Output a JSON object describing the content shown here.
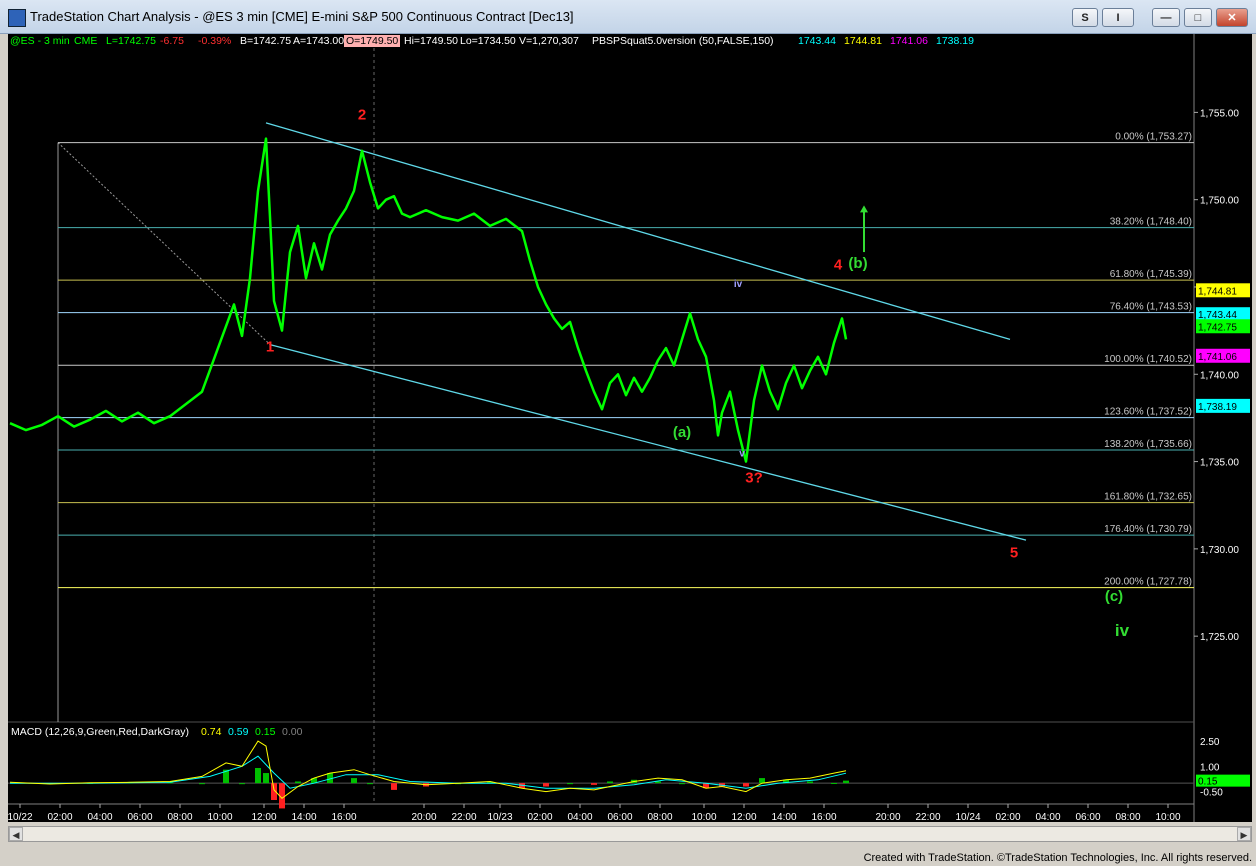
{
  "window": {
    "title": "TradeStation Chart Analysis - @ES 3 min [CME] E-mini S&P 500 Continuous Contract [Dec13]",
    "btn_s1": "S",
    "btn_s2": "I",
    "btn_min": "—",
    "btn_max": "□",
    "btn_close": "✕"
  },
  "header": {
    "symbol": "@ES - 3 min",
    "exchange": "CME",
    "last": "L=1742.75",
    "change": "-6.75",
    "pct": "-0.39%",
    "bid": "B=1742.75",
    "ask": "A=1743.00",
    "open": "O=1749.50",
    "high": "Hi=1749.50",
    "low": "Lo=1734.50",
    "volume": "V=1,270,307",
    "study": "PBSPSquat5.0version (50,FALSE,150)",
    "study_vals": [
      "1743.44",
      "1744.81",
      "1741.06",
      "1738.19"
    ]
  },
  "macd_header": {
    "label": "MACD (12,26,9,Green,Red,DarkGray)",
    "vals": [
      "0.74",
      "0.59",
      "0.15",
      "0.00"
    ]
  },
  "footer": "Created with TradeStation. ©TradeStation Technologies, Inc. All rights reserved.",
  "colors": {
    "price_bar": "#00ff00",
    "channel": "#5fd8e8",
    "wave_red": "#ff2020",
    "wave_green": "#33dd33",
    "fib_text": "#c8c8c8"
  },
  "chart_data": [
    {
      "type": "line",
      "subtype": "intraday price bars with Fibonacci levels and Elliott wave labels",
      "ylim": [
        1721.0,
        1758.0
      ],
      "y_ticks": [
        "1,755.00",
        "1,750.00",
        "1,745.00",
        "1,740.00",
        "1,735.00",
        "1,730.00",
        "1,725.00"
      ],
      "x_ticks": [
        "10/22",
        "02:00",
        "04:00",
        "06:00",
        "08:00",
        "10:00",
        "12:00",
        "14:00",
        "16:00",
        "20:00",
        "22:00",
        "10/23",
        "02:00",
        "04:00",
        "06:00",
        "08:00",
        "10:00",
        "12:00",
        "14:00",
        "16:00",
        "20:00",
        "22:00",
        "10/24",
        "02:00",
        "04:00",
        "06:00",
        "08:00",
        "10:00"
      ],
      "price_series": [
        [
          0,
          1737.2
        ],
        [
          4,
          1736.8
        ],
        [
          8,
          1737.1
        ],
        [
          12,
          1737.6
        ],
        [
          16,
          1737.0
        ],
        [
          20,
          1737.4
        ],
        [
          24,
          1737.9
        ],
        [
          28,
          1737.3
        ],
        [
          32,
          1737.8
        ],
        [
          36,
          1737.2
        ],
        [
          40,
          1737.6
        ],
        [
          44,
          1738.3
        ],
        [
          48,
          1739.0
        ],
        [
          52,
          1741.5
        ],
        [
          56,
          1744.0
        ],
        [
          58,
          1742.2
        ],
        [
          60,
          1745.5
        ],
        [
          62,
          1750.5
        ],
        [
          64,
          1753.5
        ],
        [
          65,
          1749.0
        ],
        [
          66,
          1744.2
        ],
        [
          68,
          1742.5
        ],
        [
          70,
          1747.0
        ],
        [
          72,
          1748.5
        ],
        [
          74,
          1745.5
        ],
        [
          76,
          1747.5
        ],
        [
          78,
          1746.0
        ],
        [
          80,
          1748.0
        ],
        [
          82,
          1748.8
        ],
        [
          84,
          1749.5
        ],
        [
          86,
          1750.5
        ],
        [
          88,
          1752.8
        ],
        [
          90,
          1751.0
        ],
        [
          92,
          1749.5
        ],
        [
          94,
          1750.0
        ],
        [
          96,
          1750.2
        ],
        [
          98,
          1749.2
        ],
        [
          100,
          1749.0
        ],
        [
          104,
          1749.4
        ],
        [
          108,
          1749.0
        ],
        [
          112,
          1748.8
        ],
        [
          116,
          1749.2
        ],
        [
          120,
          1748.5
        ],
        [
          124,
          1748.9
        ],
        [
          128,
          1748.2
        ],
        [
          130,
          1746.5
        ],
        [
          132,
          1745.0
        ],
        [
          134,
          1744.0
        ],
        [
          136,
          1743.2
        ],
        [
          138,
          1742.6
        ],
        [
          140,
          1743.0
        ],
        [
          142,
          1741.5
        ],
        [
          144,
          1740.2
        ],
        [
          146,
          1739.0
        ],
        [
          148,
          1738.0
        ],
        [
          150,
          1739.5
        ],
        [
          152,
          1740.0
        ],
        [
          154,
          1738.8
        ],
        [
          156,
          1739.8
        ],
        [
          158,
          1739.0
        ],
        [
          160,
          1739.8
        ],
        [
          162,
          1740.8
        ],
        [
          164,
          1741.5
        ],
        [
          166,
          1740.5
        ],
        [
          168,
          1742.0
        ],
        [
          170,
          1743.5
        ],
        [
          172,
          1742.0
        ],
        [
          174,
          1741.0
        ],
        [
          176,
          1738.5
        ],
        [
          177,
          1736.5
        ],
        [
          178,
          1737.8
        ],
        [
          180,
          1739.0
        ],
        [
          182,
          1736.8
        ],
        [
          184,
          1735.0
        ],
        [
          186,
          1738.5
        ],
        [
          188,
          1740.5
        ],
        [
          190,
          1739.0
        ],
        [
          192,
          1738.0
        ],
        [
          194,
          1739.5
        ],
        [
          196,
          1740.5
        ],
        [
          198,
          1739.2
        ],
        [
          200,
          1740.2
        ],
        [
          202,
          1741.0
        ],
        [
          204,
          1740.0
        ],
        [
          206,
          1741.8
        ],
        [
          208,
          1743.2
        ],
        [
          209,
          1742.0
        ]
      ],
      "overlay_levels": [
        {
          "label": "1,744.81",
          "value": 1744.81,
          "color": "#ffff00"
        },
        {
          "label": "1,743.44",
          "value": 1743.44,
          "color": "#00ffff"
        },
        {
          "label": "1,742.75",
          "value": 1742.75,
          "color": "#00ff00"
        },
        {
          "label": "1,741.06",
          "value": 1741.06,
          "color": "#ff00ff"
        },
        {
          "label": "1,738.19",
          "value": 1738.19,
          "color": "#00ffff"
        }
      ],
      "fib_levels": [
        {
          "label": "0.00% (1,753.27)",
          "value": 1753.27,
          "color": "#c8c8c8"
        },
        {
          "label": "38.20% (1,748.40)",
          "value": 1748.4,
          "color": "#4ab0b0"
        },
        {
          "label": "61.80% (1,745.39)",
          "value": 1745.39,
          "color": "#c8c050"
        },
        {
          "label": "76.40% (1,743.53)",
          "value": 1743.53,
          "color": "#a0d8ff"
        },
        {
          "label": "100.00% (1,740.52)",
          "value": 1740.52,
          "color": "#c8c8c8"
        },
        {
          "label": "123.60% (1,737.52)",
          "value": 1737.52,
          "color": "#a0d8ff"
        },
        {
          "label": "138.20% (1,735.66)",
          "value": 1735.66,
          "color": "#4ab0b0"
        },
        {
          "label": "161.80% (1,732.65)",
          "value": 1732.65,
          "color": "#c8c050"
        },
        {
          "label": "176.40% (1,730.79)",
          "value": 1730.79,
          "color": "#4ab0b0"
        },
        {
          "label": "200.00% (1,727.78)",
          "value": 1727.78,
          "color": "#ffff60"
        }
      ],
      "wave_labels": [
        {
          "text": "1",
          "x": 65,
          "y": 1741.3,
          "color": "#ff2020",
          "size": 15
        },
        {
          "text": "2",
          "x": 88,
          "y": 1754.6,
          "color": "#ff2020",
          "size": 15
        },
        {
          "text": "(a)",
          "x": 168,
          "y": 1736.4,
          "color": "#33dd33",
          "size": 15
        },
        {
          "text": "3?",
          "x": 186,
          "y": 1733.8,
          "color": "#ff2020",
          "size": 15
        },
        {
          "text": "4",
          "x": 207,
          "y": 1746.0,
          "color": "#ff2020",
          "size": 15
        },
        {
          "text": "(b)",
          "x": 212,
          "y": 1746.1,
          "color": "#33dd33",
          "size": 15
        },
        {
          "text": "5",
          "x": 251,
          "y": 1729.5,
          "color": "#ff2020",
          "size": 15
        },
        {
          "text": "(c)",
          "x": 276,
          "y": 1727.0,
          "color": "#33dd33",
          "size": 15
        },
        {
          "text": "iv",
          "x": 278,
          "y": 1725.0,
          "color": "#33dd33",
          "size": 17
        },
        {
          "text": "iv",
          "x": 182,
          "y": 1745.0,
          "color": "#a0a0ff",
          "size": 10
        },
        {
          "text": "v",
          "x": 183,
          "y": 1735.3,
          "color": "#a0a0ff",
          "size": 10
        }
      ],
      "channel_upper": [
        [
          64,
          1754.4
        ],
        [
          250,
          1742.0
        ]
      ],
      "channel_lower": [
        [
          65,
          1741.7
        ],
        [
          254,
          1730.5
        ]
      ],
      "fib_anchor": [
        [
          12,
          1753.27
        ],
        [
          65,
          1741.7
        ]
      ]
    },
    {
      "type": "bar",
      "subtype": "MACD histogram with MACD and signal lines",
      "ylim": [
        -1.0,
        2.8
      ],
      "y_ticks": [
        "2.50",
        "1.00",
        "-0.50"
      ],
      "overlay_levels": [
        {
          "label": "0.15",
          "value": 0.15,
          "color": "#00ff00"
        }
      ],
      "macd_line": [
        [
          0,
          0.05
        ],
        [
          10,
          -0.05
        ],
        [
          20,
          0.02
        ],
        [
          30,
          0.05
        ],
        [
          40,
          0.1
        ],
        [
          48,
          0.4
        ],
        [
          54,
          1.2
        ],
        [
          58,
          1.0
        ],
        [
          62,
          2.5
        ],
        [
          64,
          2.2
        ],
        [
          66,
          -0.4
        ],
        [
          68,
          -0.9
        ],
        [
          72,
          -0.2
        ],
        [
          76,
          0.3
        ],
        [
          80,
          0.6
        ],
        [
          86,
          0.8
        ],
        [
          90,
          0.5
        ],
        [
          96,
          0.1
        ],
        [
          104,
          -0.1
        ],
        [
          112,
          0.0
        ],
        [
          120,
          0.1
        ],
        [
          128,
          -0.3
        ],
        [
          134,
          -0.5
        ],
        [
          140,
          -0.3
        ],
        [
          146,
          -0.4
        ],
        [
          150,
          -0.2
        ],
        [
          156,
          0.1
        ],
        [
          162,
          0.3
        ],
        [
          168,
          0.2
        ],
        [
          174,
          -0.3
        ],
        [
          178,
          -0.2
        ],
        [
          184,
          -0.5
        ],
        [
          188,
          0.0
        ],
        [
          194,
          0.2
        ],
        [
          200,
          0.3
        ],
        [
          206,
          0.6
        ],
        [
          209,
          0.74
        ]
      ],
      "signal_line": [
        [
          0,
          0.0
        ],
        [
          20,
          0.0
        ],
        [
          40,
          0.05
        ],
        [
          50,
          0.4
        ],
        [
          58,
          1.0
        ],
        [
          62,
          1.6
        ],
        [
          66,
          0.6
        ],
        [
          70,
          -0.3
        ],
        [
          76,
          0.0
        ],
        [
          84,
          0.5
        ],
        [
          92,
          0.5
        ],
        [
          100,
          0.1
        ],
        [
          112,
          0.0
        ],
        [
          124,
          0.0
        ],
        [
          134,
          -0.3
        ],
        [
          146,
          -0.3
        ],
        [
          156,
          -0.1
        ],
        [
          164,
          0.2
        ],
        [
          174,
          0.0
        ],
        [
          184,
          -0.3
        ],
        [
          192,
          0.0
        ],
        [
          202,
          0.2
        ],
        [
          209,
          0.59
        ]
      ]
    }
  ]
}
